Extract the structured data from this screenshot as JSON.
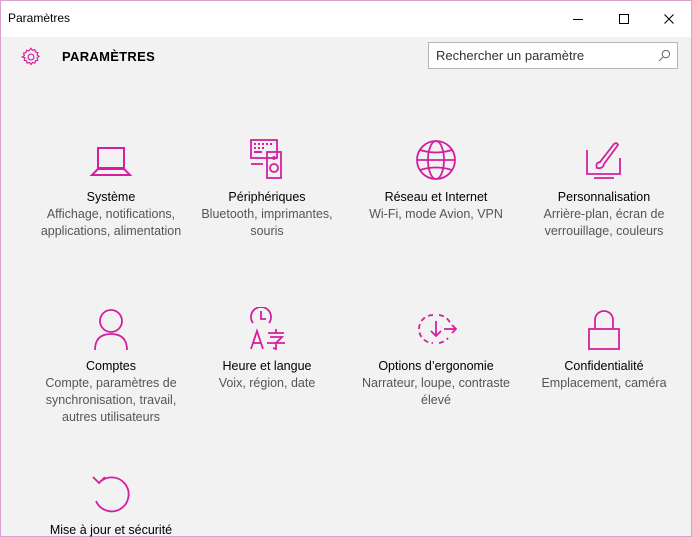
{
  "window": {
    "title": "Paramètres"
  },
  "header": {
    "title": "PARAMÈTRES"
  },
  "search": {
    "placeholder": "Rechercher un paramètre"
  },
  "colors": {
    "accent": "#d4209f"
  },
  "tiles": [
    {
      "name": "Système",
      "desc": "Affichage, notifications, applications, alimentation",
      "icon": "laptop-icon"
    },
    {
      "name": "Périphériques",
      "desc": "Bluetooth, imprimantes, souris",
      "icon": "devices-icon"
    },
    {
      "name": "Réseau et Internet",
      "desc": "Wi-Fi, mode Avion, VPN",
      "icon": "globe-icon"
    },
    {
      "name": "Personnalisation",
      "desc": "Arrière-plan, écran de verrouillage, couleurs",
      "icon": "paintbrush-icon"
    },
    {
      "name": "Comptes",
      "desc": "Compte, paramètres de synchronisation, travail, autres utilisateurs",
      "icon": "person-icon"
    },
    {
      "name": "Heure et langue",
      "desc": "Voix, région, date",
      "icon": "time-language-icon"
    },
    {
      "name": "Options d’ergonomie",
      "desc": "Narrateur, loupe, contraste élevé",
      "icon": "ease-of-access-icon"
    },
    {
      "name": "Confidentialité",
      "desc": "Emplacement, caméra",
      "icon": "lock-icon"
    },
    {
      "name": "Mise à jour et sécurité",
      "desc": "",
      "icon": "update-icon"
    }
  ]
}
